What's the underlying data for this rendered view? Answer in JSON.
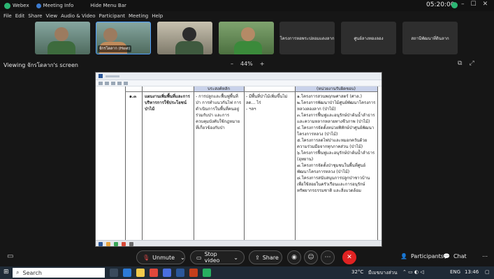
{
  "app": {
    "title": "Webex",
    "meeting_info": "Meeting Info",
    "hide_menu": "Hide Menu Bar",
    "clock": "05:20:00"
  },
  "menu": [
    "File",
    "Edit",
    "Share",
    "View",
    "Audio & Video",
    "Participant",
    "Meeting",
    "Help"
  ],
  "tiles": [
    {
      "type": "video"
    },
    {
      "type": "video",
      "label": "จักรโดลาก (Host)"
    },
    {
      "type": "video"
    },
    {
      "type": "video"
    },
    {
      "type": "name",
      "label": "โครงการหอพระปลอมแดงลาก"
    },
    {
      "type": "name",
      "label": "ศูนย์ลางทองลอง"
    },
    {
      "type": "name",
      "label": "สถานีพัฒนาที่ดินลาก"
    }
  ],
  "viewing": "Viewing จักรโดลาก's screen",
  "zoom": {
    "minus": "–",
    "level": "44%",
    "plus": "+"
  },
  "doc": {
    "header_col2": "บระสงค์หลัก",
    "header_col4": "(หน่วยงานรับผิดชอบ)",
    "row_no": "๑.๓",
    "strategy": "แผนงานเพิ่มพื้นที่และการบริหารการใช้ประโยชน์ป่าไม้",
    "objectives": "- การปลูกและฟื้นฟูพื้นที่ป่า การทำแนวกันไฟ การดำเนินการในพื้นที่คนอยู่ร่วมกับป่า และการควบคุมบังคับใช้กฎหมายที่เกี่ยวข้องกับป่า",
    "indicators": "- มีพื้นที่ป่าไม้เพิ่มขึ้นไม่ลด... ไร่\n- ฯลฯ",
    "projects": [
      "๑.โครงการสวนพฤกษศาสตร์ (ศาล.)",
      "๒.โครงการพัฒนาป่าไม้ศูนย์พัฒนาโครงการหลวงลองลาก (ป่าไม้)",
      "๓.โครงการฟื้นฟูและอนุรักษ์ป่าต้นน้ำลำธาร และความหลากหลายทางชีวภาพ (ป่าไม้)",
      "๔.โครงการจัดตั้งหน่วยพิทักษ์ป่าศูนย์พัฒนาโครงการหลวง (ป่าไม้)",
      "๕.โครงการลดไฟป่าและหมอกควันด้วยความร่วมมือจากทุกภาคส่วน (ป่าไม้)",
      "๖.โครงการฟื้นฟูและอนุรักษ์ป่าต้นน้ำลำธาร (อุทยาน)",
      "๗.โครงการจัดตั้งป่าชุมชนในพื้นที่ศูนย์พัฒนาโครงการหลวง (ป่าไม้)",
      "๘.โครงการสนับสนุนการปลูกป่าชาวบ้านเพื่อใช้สอยในครัวเรือนและการอนุรักษ์ทรัพยากรธรรมชาติ และสิ่งแวดล้อม"
    ]
  },
  "controls": {
    "unmute": "Unmute",
    "stop_video": "Stop video",
    "share": "Share",
    "participants": "Participants",
    "chat": "Chat"
  },
  "taskbar": {
    "search": "Search",
    "temp": "32°C",
    "weather": "มีเมฆบางส่วน",
    "lang": "ENG",
    "time": "13:46"
  },
  "colors": {
    "end_call": "#e02222",
    "accent": "#3c7bd0"
  }
}
